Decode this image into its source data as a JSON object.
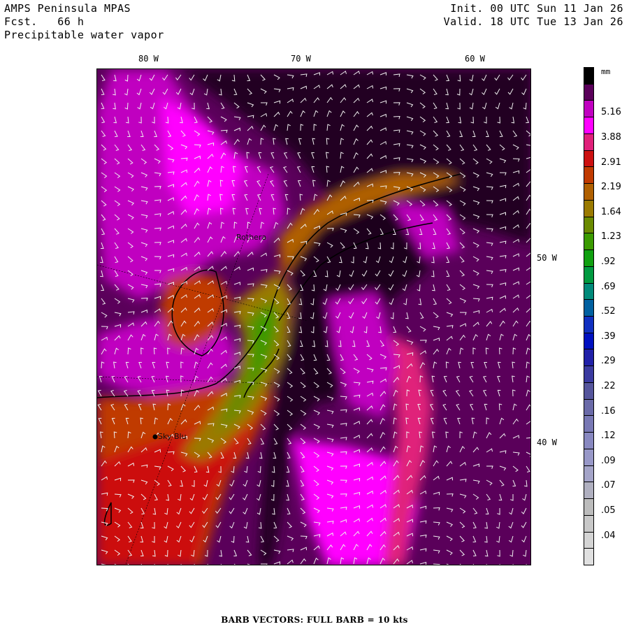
{
  "header": {
    "model": "AMPS Peninsula MPAS",
    "forecast": "Fcst.   66 h",
    "field": "Precipitable water vapor",
    "init": "Init. 00 UTC Sun 11 Jan 26",
    "valid": "Valid. 18 UTC Tue 13 Jan 26"
  },
  "axes": {
    "lon_labels": [
      "80 W",
      "70 W",
      "60 W"
    ],
    "lat_labels": [
      "50 W",
      "40 W"
    ]
  },
  "stations": [
    {
      "name": "Rothera"
    },
    {
      "name": "Sky Blu"
    }
  ],
  "colorbar": {
    "unit": "mm",
    "labels": [
      "5.16",
      "3.88",
      "2.91",
      "2.19",
      "1.64",
      "1.23",
      ".92",
      ".69",
      ".52",
      ".39",
      ".29",
      ".22",
      ".16",
      ".12",
      ".09",
      ".07",
      ".05",
      ".04"
    ],
    "colors": [
      "#000000",
      "#5a005a",
      "#c000c0",
      "#ff00ff",
      "#e0207a",
      "#cc1010",
      "#c03a00",
      "#b06000",
      "#9a7a00",
      "#6a8a00",
      "#3a9a00",
      "#10a010",
      "#009a40",
      "#008a7a",
      "#0060a0",
      "#1030c0",
      "#0010c0",
      "#2020a8",
      "#3a3aa0",
      "#55559c",
      "#6a6aa8",
      "#7878b4",
      "#8888c0",
      "#9898c8",
      "#a4a4c8",
      "#b0b0c0",
      "#bcbcbc",
      "#c8c8c8",
      "#d4d4d4",
      "#e0e0e0"
    ]
  },
  "footer": "BARB VECTORS:  FULL BARB = 10 kts"
}
